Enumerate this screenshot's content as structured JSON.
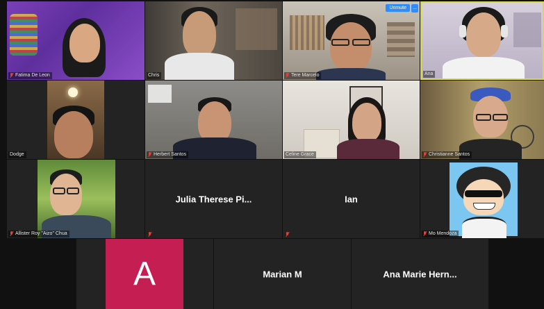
{
  "colors": {
    "background": "#111111",
    "tile": "#232323",
    "active_speaker_border": "#d6d94a",
    "muted_icon": "#e0423a",
    "unmute_button": "#2d8cff",
    "avatar_a": "#c51e52"
  },
  "controls": {
    "unmute_label": "Unmute",
    "more_label": "..."
  },
  "participants": [
    {
      "name": "Fatima De Leon",
      "muted": true
    },
    {
      "name": "Chris",
      "muted": false
    },
    {
      "name": "Tere Marcelo",
      "muted": true
    },
    {
      "name": "Ana",
      "muted": false
    },
    {
      "name": "Dodge",
      "muted": false
    },
    {
      "name": "Herbert Santos",
      "muted": true
    },
    {
      "name": "Celine Grace",
      "muted": false
    },
    {
      "name": "Christianne Santos",
      "muted": true
    },
    {
      "name": "Allister Roy \"Aizo\" Chua",
      "muted": true
    },
    {
      "name": "Julia Therese Pi...",
      "muted": true
    },
    {
      "name": "Ian",
      "muted": true
    },
    {
      "name": "Mo Mendoza",
      "muted": true
    },
    {
      "name": "A",
      "muted": false
    },
    {
      "name": "Marian M",
      "muted": false
    },
    {
      "name": "Ana Marie Hern...",
      "muted": false
    }
  ]
}
